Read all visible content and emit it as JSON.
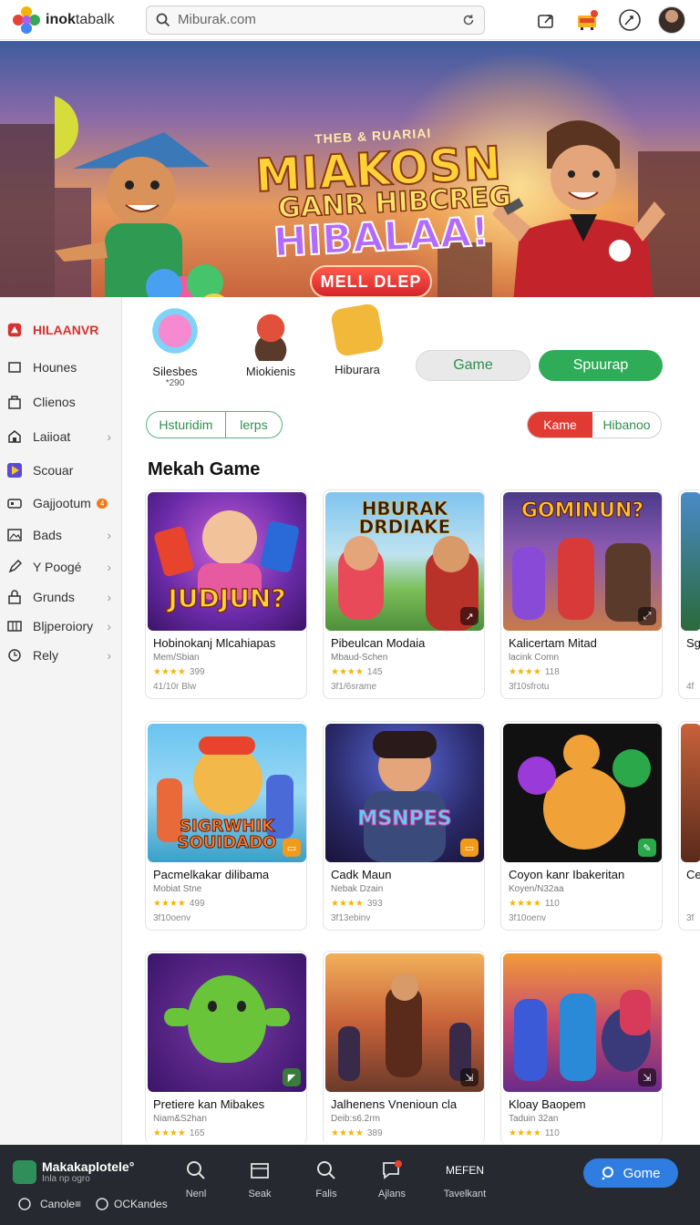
{
  "header": {
    "logo_bold": "inok",
    "logo_rest": "tabalk",
    "search_text": "Miburak.com"
  },
  "hero": {
    "eyebrow": "THEB & RUARIAI",
    "title_line1": "MIAKOSN",
    "title_line2": "GANR HIBCREG",
    "title_line3": "HIBALAA!",
    "cta": "MELL DLEP"
  },
  "sidebar": {
    "items": [
      {
        "label": "HILAANVR",
        "icon": "home-logo-icon",
        "active": true
      },
      {
        "label": "Hounes",
        "icon": "square-icon"
      },
      {
        "label": "Clienos",
        "icon": "bag-icon"
      },
      {
        "label": "Laiioat",
        "icon": "house-icon"
      },
      {
        "label": "Scouar",
        "icon": "play-icon"
      },
      {
        "label": "Gajjootum",
        "icon": "controller-icon",
        "badge": "4"
      },
      {
        "label": "Bads",
        "icon": "image-icon"
      },
      {
        "label": "Y Poogé",
        "icon": "pen-icon"
      },
      {
        "label": "Grunds",
        "icon": "lock-icon"
      },
      {
        "label": "Bljperoiory",
        "icon": "grid-icon"
      },
      {
        "label": "Rely",
        "icon": "clock-icon"
      }
    ]
  },
  "categories": [
    {
      "label": "Silesbes",
      "sub": "*290"
    },
    {
      "label": "Miokienis"
    },
    {
      "label": "Hiburara"
    }
  ],
  "pills": {
    "game": "Game",
    "signup": "Spuurap"
  },
  "filters": {
    "left": [
      "Hsturidim",
      "lerps"
    ],
    "right": [
      "Kame",
      "Hibanoo"
    ]
  },
  "section_title": "Mekah Game",
  "cards": [
    {
      "thumb_title": "JUDJUN?",
      "title": "Hobinokanj Mlcahiapas",
      "sub": "Mem/Sbian",
      "rating": "★★★★",
      "count": "399",
      "meta": "41/10r Blw"
    },
    {
      "thumb_title": "HBURAK DRDIAKE",
      "title": "Pibeulcan Modaia",
      "sub": "Mbaud-Schen",
      "rating": "★★★★",
      "count": "145",
      "meta": "3f1/6srame"
    },
    {
      "thumb_title": "GOMINUN?",
      "title": "Kalicertam Mitad",
      "sub": "lacink Comn",
      "rating": "★★★★",
      "count": "118",
      "meta": "3f10sfrotu"
    },
    {
      "thumb_title": "SIGRWHIK SOUIDADO",
      "title": "Pacmelkakar dilibama",
      "sub": "Mobiat Stne",
      "rating": "★★★★",
      "count": "499",
      "meta": "3f10oenv"
    },
    {
      "thumb_title": "MSNPES",
      "title": "Cadk Maun",
      "sub": "Nebak Dzain",
      "rating": "★★★★",
      "count": "393",
      "meta": "3f13ebinv"
    },
    {
      "thumb_title": "",
      "title": "Coyon kanr Ibakeritan",
      "sub": "Koyen/N32aa",
      "rating": "★★★★",
      "count": "110",
      "meta": "3f10oenv"
    },
    {
      "thumb_title": "",
      "title": "Pretiere kan Mibakes",
      "sub": "Niam&S2han",
      "rating": "★★★★",
      "count": "165",
      "meta": ""
    },
    {
      "thumb_title": "",
      "title": "Jalhenens Vnenioun cla",
      "sub": "Deib:s6.2rm",
      "rating": "★★★★",
      "count": "389",
      "meta": ""
    },
    {
      "thumb_title": "",
      "title": "Kloay Baopem",
      "sub": "Taduin 32an",
      "rating": "★★★★",
      "count": "110",
      "meta": ""
    }
  ],
  "peek": [
    {
      "title": "Sg",
      "meta": "4f"
    },
    {
      "title": "Ce",
      "meta": "3f"
    }
  ],
  "bottombar": {
    "app_name": "Makakaplotele°",
    "app_sub": "Inla np ogro",
    "nav": [
      "Nenl",
      "Seak",
      "Falis",
      "Ajlans",
      "Tavelkant"
    ],
    "nav_top_text": "MEFEN",
    "cta": "Gome",
    "foot_left": "Canole≡",
    "foot_right": "OCKandes"
  }
}
